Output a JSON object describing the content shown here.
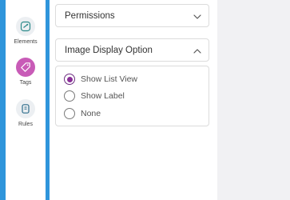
{
  "sidebar": {
    "items": [
      {
        "label": "Elements",
        "icon": "elements-icon",
        "active": false
      },
      {
        "label": "Tags",
        "icon": "tag-icon",
        "active": true
      },
      {
        "label": "Rules",
        "icon": "rules-icon",
        "active": false
      }
    ]
  },
  "panels": {
    "permissions": {
      "title": "Permissions",
      "expanded": false
    },
    "image_display": {
      "title": "Image Display Option",
      "expanded": true
    }
  },
  "image_display_options": [
    {
      "label": "Show List View",
      "selected": true
    },
    {
      "label": "Show Label",
      "selected": false
    },
    {
      "label": "None",
      "selected": false
    }
  ],
  "colors": {
    "accent_blue": "#2f95db",
    "active_nav": "#c85bb7",
    "radio_selected": "#8a2f98"
  }
}
